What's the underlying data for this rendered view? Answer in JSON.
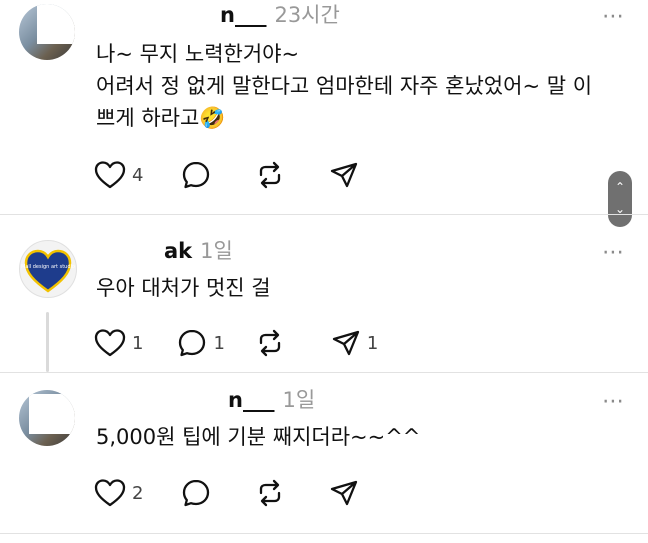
{
  "posts": [
    {
      "username": "n___",
      "time": "23시간",
      "lines": [
        "나~ 무지 노력한거야~",
        "어려서 정 없게 말한다고 엄마한테 자주 혼났었어~ 말 이",
        "쁘게 하라고🤣"
      ],
      "likes": "4",
      "replies": "",
      "shares": ""
    },
    {
      "username": "ak",
      "time": "1일",
      "avatar_text": "Mall design art studio",
      "lines": [
        "우아 대처가 멋진 걸"
      ],
      "likes": "1",
      "replies": "1",
      "shares": "1"
    },
    {
      "username": "n___",
      "time": "1일",
      "lines": [
        "5,000원 팁에 기분 째지더라~~^^"
      ],
      "likes": "2",
      "replies": "",
      "shares": ""
    }
  ],
  "more_icon": "⋯",
  "scroll_up": "⌃",
  "scroll_down": "⌄",
  "colors": {
    "text": "#101010",
    "muted": "#999999",
    "divider": "#e2e2e2",
    "heart_blue": "#1e3c8c",
    "heart_yellow": "#f2c200"
  }
}
